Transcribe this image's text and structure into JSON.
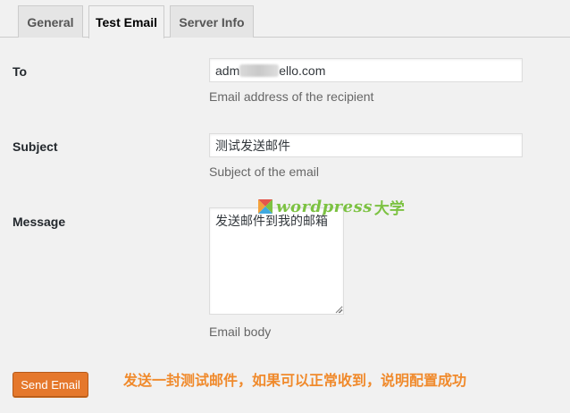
{
  "tabs": [
    {
      "label": "General",
      "active": false
    },
    {
      "label": "Test Email",
      "active": true
    },
    {
      "label": "Server Info",
      "active": false
    }
  ],
  "form": {
    "to": {
      "label": "To",
      "value_prefix": "adm",
      "value_suffix": "ello.com",
      "description": "Email address of the recipient"
    },
    "subject": {
      "label": "Subject",
      "value": "测试发送邮件",
      "description": "Subject of the email"
    },
    "message": {
      "label": "Message",
      "value": "发送邮件到我的邮箱",
      "description": "Email body"
    }
  },
  "actions": {
    "send_label": "Send Email"
  },
  "annotation": {
    "text": "发送一封测试邮件，如果可以正常收到，说明配置成功",
    "color": "#f08a2c"
  },
  "watermark": {
    "text": "wordpress",
    "cn": "大学",
    "color": "#7cc242"
  },
  "colors": {
    "accent": "#e5782c",
    "background": "#f1f1f1"
  }
}
